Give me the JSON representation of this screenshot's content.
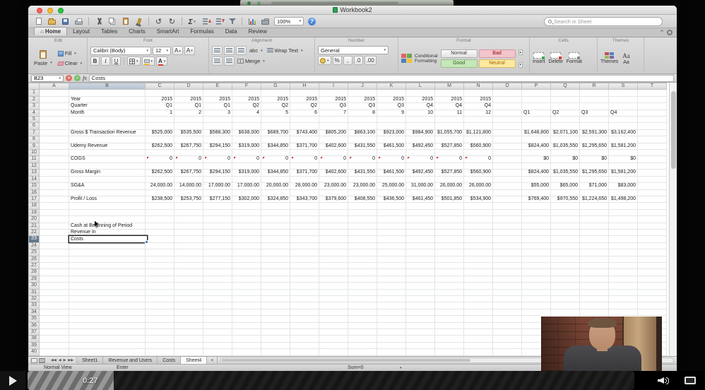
{
  "player": {
    "time_label": "0:27"
  },
  "window": {
    "title": "Workbook2"
  },
  "toolbar": {
    "zoom": "100%",
    "search_placeholder": "Search in Sheet",
    "icons": [
      "new-workbook",
      "open",
      "save",
      "print",
      "sep",
      "cut",
      "copy",
      "paste",
      "format-painter",
      "sep",
      "undo",
      "redo",
      "sep",
      "autosum",
      "sort-ascending",
      "sort-descending",
      "filter",
      "sep",
      "chart",
      "toolbox"
    ]
  },
  "ribbon": {
    "tabs": [
      {
        "label": "Home",
        "active": true,
        "home_icon": true
      },
      {
        "label": "Layout"
      },
      {
        "label": "Tables"
      },
      {
        "label": "Charts"
      },
      {
        "label": "SmartArt"
      },
      {
        "label": "Formulas"
      },
      {
        "label": "Data"
      },
      {
        "label": "Review"
      }
    ],
    "groups": {
      "edit": {
        "label": "Edit",
        "paste": "Paste",
        "fill": "Fill",
        "clear": "Clear"
      },
      "font": {
        "label": "Font",
        "name": "Calibri (Body)",
        "size": "12",
        "bold": "B",
        "italic": "I",
        "underline": "U"
      },
      "alignment": {
        "label": "Alignment",
        "abc": "abc",
        "wrap": "Wrap Text",
        "merge": "Merge"
      },
      "number": {
        "label": "Number",
        "format": "General",
        "percent": "%",
        "comma": ",",
        "inc_decimal": ".0",
        "dec_decimal": ".00"
      },
      "format": {
        "label": "Format",
        "conditional_line1": "Conditional",
        "conditional_line2": "Formatting",
        "styles": [
          {
            "label": "Normal",
            "type": "normal",
            "bg": "#f2f2f2"
          },
          {
            "label": "Bad",
            "type": "bad",
            "bg": "#f2c4cb"
          },
          {
            "label": "Good",
            "type": "good",
            "bg": "#c6e7b8"
          },
          {
            "label": "Neutral",
            "type": "neutral",
            "bg": "#ffe9a0"
          }
        ]
      },
      "cells": {
        "label": "Cells",
        "buttons": [
          "Insert",
          "Delete",
          "Format"
        ]
      },
      "themes": {
        "label": "Themes",
        "theme_button": "Themes",
        "aa_button": "Aa"
      }
    }
  },
  "formula_bar": {
    "cell_ref": "B23",
    "fx_label": "fx",
    "value": "Costs"
  },
  "sheet": {
    "columns": [
      "A",
      "B",
      "C",
      "D",
      "E",
      "F",
      "G",
      "H",
      "I",
      "J",
      "K",
      "L",
      "M",
      "N",
      "O",
      "P",
      "Q",
      "R",
      "S",
      "T"
    ],
    "row_count": 41,
    "selected_row": 23,
    "selected_col": "B",
    "active_cell": "B23",
    "rows": [
      {
        "r": 2,
        "label": "Year",
        "monthly": [
          "2015",
          "2015",
          "2015",
          "2015",
          "2015",
          "2015",
          "2015",
          "2015",
          "2015",
          "2015",
          "2015",
          "2015"
        ]
      },
      {
        "r": 3,
        "label": "Quarter",
        "monthly": [
          "Q1",
          "Q1",
          "Q1",
          "Q2",
          "Q2",
          "Q2",
          "Q3",
          "Q3",
          "Q3",
          "Q4",
          "Q4",
          "Q4"
        ]
      },
      {
        "r": 4,
        "label": "Month",
        "monthly": [
          "1",
          "2",
          "3",
          "4",
          "5",
          "6",
          "7",
          "8",
          "9",
          "10",
          "11",
          "12"
        ],
        "quarterly": [
          "Q1",
          "Q2",
          "Q3",
          "Q4"
        ],
        "quarterly_align": "left"
      },
      {
        "r": 7,
        "label": "Gross $ Transaction Revenue",
        "monthly": [
          "$525,000",
          "$535,500",
          "$588,300",
          "$638,000",
          "$689,700",
          "$743,400",
          "$805,200",
          "$863,100",
          "$923,000",
          "$984,900",
          "$1,055,700",
          "$1,121,800"
        ],
        "quarterly": [
          "$1,648,800",
          "$2,071,100",
          "$2,591,300",
          "$3,162,400"
        ]
      },
      {
        "r": 9,
        "label": "Udemy Revenue",
        "monthly": [
          "$262,500",
          "$267,750",
          "$294,150",
          "$319,000",
          "$344,850",
          "$371,700",
          "$402,600",
          "$431,550",
          "$461,500",
          "$492,450",
          "$527,850",
          "$560,900"
        ],
        "quarterly": [
          "$824,400",
          "$1,035,550",
          "$1,295,650",
          "$1,581,200"
        ]
      },
      {
        "r": 11,
        "label": "COGS",
        "monthly": [
          "0",
          "0",
          "0",
          "0",
          "0",
          "0",
          "0",
          "0",
          "0",
          "0",
          "0",
          "0"
        ],
        "quarterly": [
          "$0",
          "$0",
          "$0",
          "$0"
        ],
        "error_marker": true
      },
      {
        "r": 13,
        "label": "Gross Margin",
        "monthly": [
          "$262,500",
          "$267,750",
          "$294,150",
          "$319,000",
          "$344,850",
          "$371,700",
          "$402,600",
          "$431,550",
          "$461,500",
          "$492,450",
          "$527,850",
          "$560,900"
        ],
        "quarterly": [
          "$824,400",
          "$1,035,550",
          "$1,295,650",
          "$1,581,200"
        ]
      },
      {
        "r": 15,
        "label": "SG&A",
        "monthly": [
          "24,000.00",
          "14,000.00",
          "17,000.00",
          "17,000.00",
          "20,000.00",
          "28,000.00",
          "23,000.00",
          "23,000.00",
          "25,000.00",
          "31,000.00",
          "26,000.00",
          "26,000.00"
        ],
        "quarterly": [
          "$55,000",
          "$65,000",
          "$71,000",
          "$83,000"
        ]
      },
      {
        "r": 17,
        "label": "Profit / Loss",
        "monthly": [
          "$238,500",
          "$253,750",
          "$277,150",
          "$302,000",
          "$324,850",
          "$343,700",
          "$379,600",
          "$408,550",
          "$436,500",
          "$461,450",
          "$501,850",
          "$534,900"
        ],
        "quarterly": [
          "$769,400",
          "$970,550",
          "$1,224,650",
          "$1,498,200"
        ]
      },
      {
        "r": 21,
        "label": "Cash at Beginning of Period",
        "cursor": true
      },
      {
        "r": 22,
        "label": "Revenue In"
      },
      {
        "r": 23,
        "label": "Costs",
        "editing": true
      }
    ]
  },
  "sheet_tabs": {
    "tabs": [
      {
        "label": "Sheet1"
      },
      {
        "label": "Revenue and Users"
      },
      {
        "label": "Costs"
      },
      {
        "label": "Sheet4",
        "active": true
      }
    ],
    "add_label": "+"
  },
  "status_bar": {
    "view_label": "Normal View",
    "mode_label": "Enter",
    "sum_label": "Sum=0"
  },
  "colors": {
    "traffic_red": "#ff5f57",
    "traffic_yellow": "#febc2e",
    "traffic_green": "#28c840",
    "selected_row_header": "#5c6f82",
    "style_bad_text": "#9c0006",
    "style_good_text": "#276221",
    "style_neutral_text": "#9c6500",
    "help_blue": "#3a78c9"
  }
}
